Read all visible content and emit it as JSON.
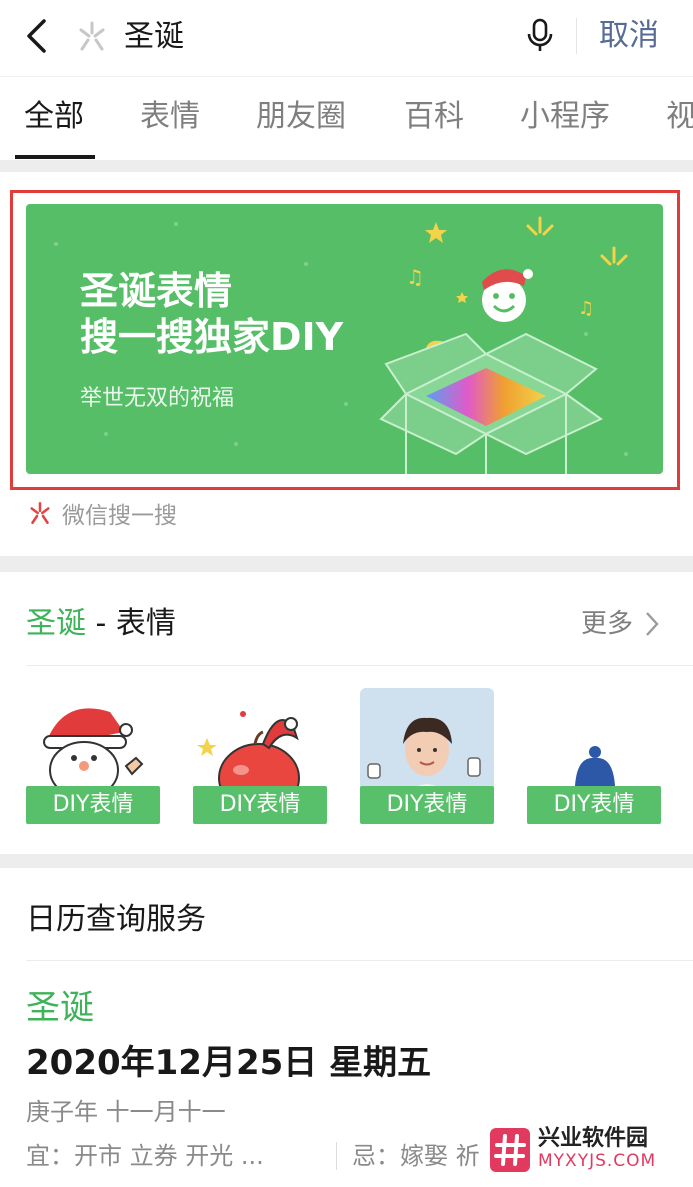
{
  "search": {
    "query": "圣诞",
    "cancel_label": "取消"
  },
  "tabs": [
    {
      "label": "全部",
      "active": true
    },
    {
      "label": "表情"
    },
    {
      "label": "朋友圈"
    },
    {
      "label": "百科"
    },
    {
      "label": "小程序"
    },
    {
      "label": "视"
    }
  ],
  "banner": {
    "title_line1": "圣诞表情",
    "title_line2": "搜一搜独家DIY",
    "subtitle": "举世无双的祝福",
    "source": "微信搜一搜",
    "bg_color": "#56be67",
    "highlight_color": "#e03c3c"
  },
  "stickers": {
    "title_highlight": "圣诞",
    "title_rest": " - 表情",
    "more_label": "更多",
    "items": [
      {
        "tag": "DIY表情",
        "icon": "santa-sticker-icon"
      },
      {
        "tag": "DIY表情",
        "icon": "apple-santa-hat-sticker-icon"
      },
      {
        "tag": "DIY表情",
        "icon": "person-photo-sticker-icon"
      },
      {
        "tag": "DIY表情",
        "icon": "blue-hat-sticker-icon"
      }
    ]
  },
  "calendar": {
    "section_title": "日历查询服务",
    "holiday": "圣诞",
    "date": "2020年12月25日 星期五",
    "lunar": "庚子年 十一月十一",
    "yi": "宜：开市 立券 开光 ...",
    "ji": "忌：嫁娶 祈"
  },
  "watermark": {
    "line1": "兴业软件园",
    "line2": "MYXYJS.COM"
  },
  "colors": {
    "accent_green": "#3fb35a",
    "link_blue": "#576b95"
  }
}
